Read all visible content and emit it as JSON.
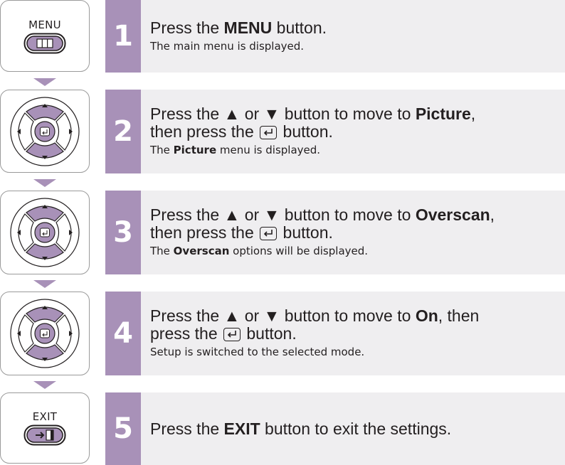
{
  "colors": {
    "accent_purple": "#a891b8",
    "step_background": "#efeef0",
    "text": "#231f20",
    "icon_border": "#9a9a9a"
  },
  "steps": [
    {
      "number": "1",
      "remote_icon": "menu-button",
      "remote_label": "MENU",
      "main_before": "Press the ",
      "main_bold": "MENU",
      "main_after": " button.",
      "sub": "The main menu is displayed."
    },
    {
      "number": "2",
      "remote_icon": "direction-pad",
      "main_before": "Press the ▲ or ▼ button to move to ",
      "main_bold": "Picture",
      "main_after": ",",
      "main_line2_before": "then press the",
      "main_line2_after": "button.",
      "sub_bold": "Picture",
      "sub_after": " menu is displayed.",
      "sub_before": "The "
    },
    {
      "number": "3",
      "remote_icon": "direction-pad",
      "main_before": "Press the ▲ or ▼ button to move to ",
      "main_bold": "Overscan",
      "main_after": ",",
      "main_line2_before": "then press the",
      "main_line2_after": "button.",
      "sub_before": "The ",
      "sub_bold": "Overscan",
      "sub_after": " options will be displayed."
    },
    {
      "number": "4",
      "remote_icon": "direction-pad",
      "main_before": "Press the ▲ or ▼ button to move to ",
      "main_bold": "On",
      "main_after": ", then",
      "main_line2_before": "press the",
      "main_line2_after": "button.",
      "sub": "Setup is switched to the selected mode."
    },
    {
      "number": "5",
      "remote_icon": "exit-button",
      "remote_label": "EXIT",
      "main_before": "Press the ",
      "main_bold": "EXIT",
      "main_after": " button to exit the settings."
    }
  ]
}
